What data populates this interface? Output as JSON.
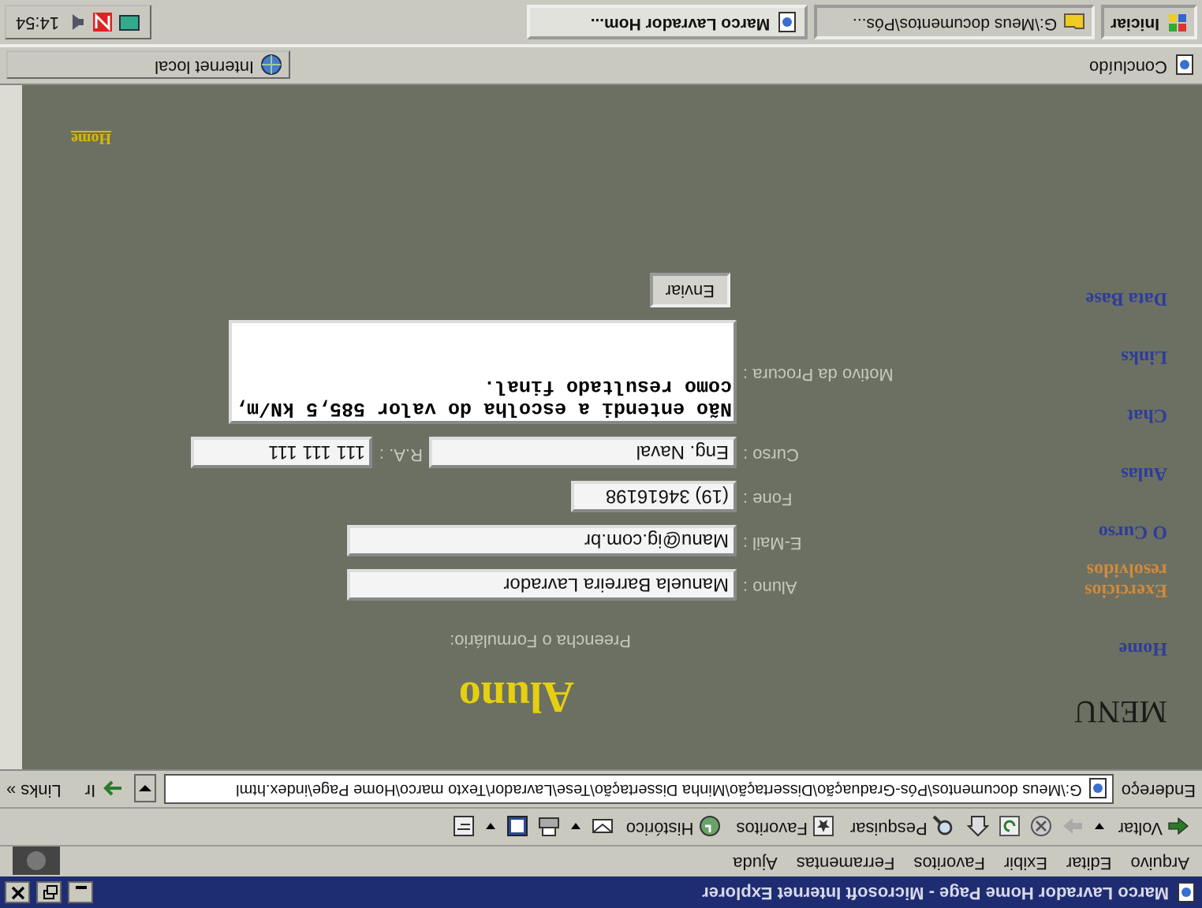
{
  "window": {
    "title": "Marco Lavrador Home Page - Microsoft Internet Explorer"
  },
  "menu_bar": [
    "Arquivo",
    "Editar",
    "Exibir",
    "Favoritos",
    "Ferramentas",
    "Ajuda"
  ],
  "toolbar": [
    "Voltar",
    "Pesquisar",
    "Favoritos",
    "Histórico"
  ],
  "address_bar": {
    "label": "Endereço",
    "value": "G:\\Meus documentos\\Pós-Graduação\\Dissertação\\Minha Dissertação\\Tese\\Lavrador\\Texto marco\\Home Page\\index.html",
    "go": "Ir",
    "links": "Links »"
  },
  "page": {
    "menu_title": "MENU",
    "menu_links": [
      {
        "label": "Home",
        "color": "#2e3c9c"
      },
      {
        "label": "Exercícios resolvidos",
        "color": "#d08a3c"
      },
      {
        "label": "O Curso",
        "color": "#2e3c9c"
      },
      {
        "label": "Aulas",
        "color": "#2e3c9c"
      },
      {
        "label": "Chat",
        "color": "#2e3c9c"
      },
      {
        "label": "Links",
        "color": "#2e3c9c"
      },
      {
        "label": "Data Base",
        "color": "#2e3c9c"
      }
    ],
    "heading": "Aluno",
    "instruction": "Preencha o Formulário:",
    "fields": [
      {
        "kind": "text",
        "label": "Aluno :",
        "value": "Manuela Barreira Lavrador"
      },
      {
        "kind": "text",
        "label": "E-Mail :",
        "value": "Manu@ig.com.br"
      },
      {
        "kind": "text",
        "label": "Fone :",
        "value": "(19) 34616198"
      },
      {
        "kind": "pair",
        "label": "Curso :",
        "value": "Eng. Naval",
        "label_2": "R.A. :",
        "value_2": "111 111 111"
      },
      {
        "kind": "textarea",
        "label": "Motivo da Procura :",
        "value": "Não entendi a escolha do valor 585,5 kN/m, como resultado final."
      }
    ],
    "submit": "Enviar",
    "home_link": "Home"
  },
  "status_bar": {
    "text": "Concluído",
    "zone": "Internet local"
  },
  "taskbar": {
    "start": "Iniciar",
    "tasks": [
      {
        "label": "G:\\Meus documentos\\Pós...",
        "selected": false
      },
      {
        "label": "Marco Lavrador Hom...",
        "selected": true
      }
    ],
    "clock": "14:54"
  }
}
